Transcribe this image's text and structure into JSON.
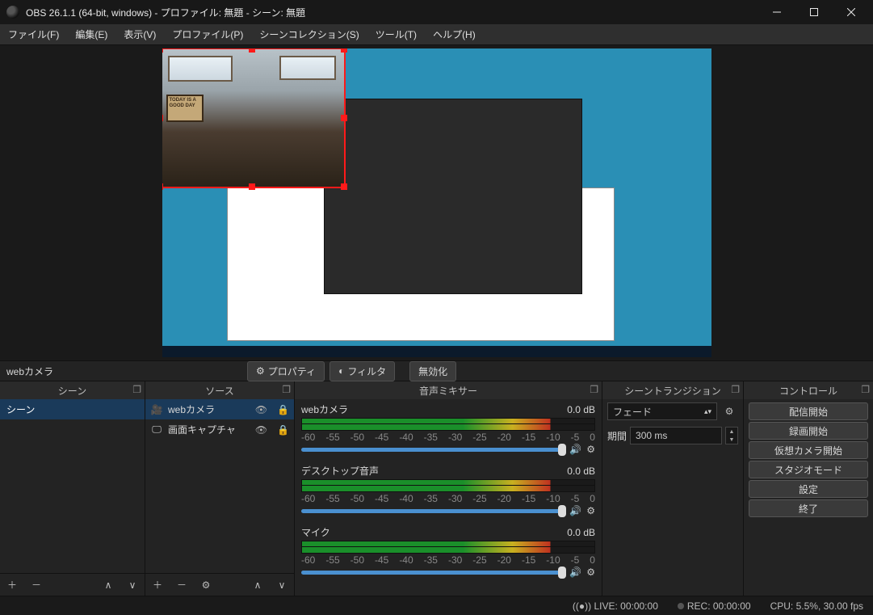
{
  "window": {
    "title": "OBS 26.1.1 (64-bit, windows) - プロファイル: 無題 - シーン: 無題"
  },
  "menu": {
    "file": "ファイル(F)",
    "edit": "編集(E)",
    "view": "表示(V)",
    "profile": "プロファイル(P)",
    "scene_collection": "シーンコレクション(S)",
    "tools": "ツール(T)",
    "help": "ヘルプ(H)"
  },
  "source_bar": {
    "selected": "webカメラ",
    "properties": "プロパティ",
    "filters": "フィルタ",
    "disable": "無効化"
  },
  "panels": {
    "scenes_title": "シーン",
    "sources_title": "ソース",
    "mixer_title": "音声ミキサー",
    "transitions_title": "シーントランジション",
    "controls_title": "コントロール"
  },
  "scenes": {
    "items": [
      "シーン"
    ]
  },
  "sources": {
    "items": [
      {
        "icon": "camera-icon",
        "label": "webカメラ",
        "selected": true
      },
      {
        "icon": "monitor-icon",
        "label": "画面キャプチャ",
        "selected": false
      }
    ]
  },
  "mixer": {
    "ticks": [
      "-60",
      "-55",
      "-50",
      "-45",
      "-40",
      "-35",
      "-30",
      "-25",
      "-20",
      "-15",
      "-10",
      "-5",
      "0"
    ],
    "channels": [
      {
        "name": "webカメラ",
        "db": "0.0 dB"
      },
      {
        "name": "デスクトップ音声",
        "db": "0.0 dB"
      },
      {
        "name": "マイク",
        "db": "0.0 dB"
      }
    ]
  },
  "transitions": {
    "selected": "フェード",
    "duration_label": "期間",
    "duration_value": "300 ms"
  },
  "controls": {
    "start_stream": "配信開始",
    "start_record": "録画開始",
    "virtual_cam": "仮想カメラ開始",
    "studio_mode": "スタジオモード",
    "settings": "設定",
    "exit": "終了"
  },
  "status": {
    "live": "LIVE: 00:00:00",
    "rec": "REC: 00:00:00",
    "cpu": "CPU: 5.5%, 30.00 fps"
  },
  "webcam_sign": "TODAY IS A GOOD DAY"
}
